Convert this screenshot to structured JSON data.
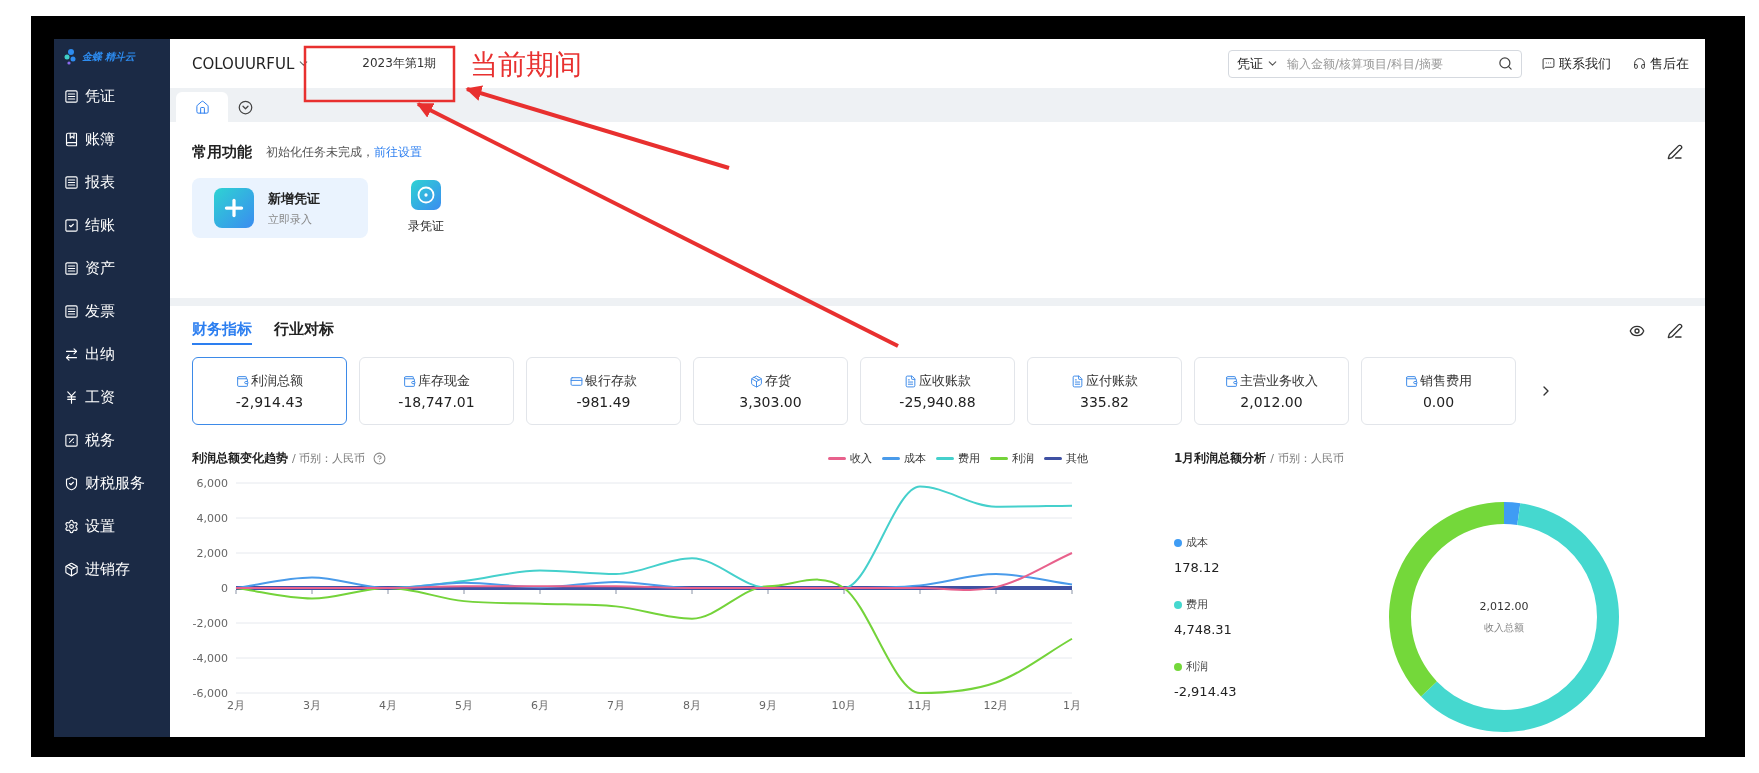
{
  "logo": {
    "text": "金蝶 精斗云"
  },
  "sidebar": {
    "items": [
      {
        "label": "凭证",
        "kind": "doc"
      },
      {
        "label": "账簿",
        "kind": "book"
      },
      {
        "label": "报表",
        "kind": "doc"
      },
      {
        "label": "结账",
        "kind": "check"
      },
      {
        "label": "资产",
        "kind": "doc"
      },
      {
        "label": "发票",
        "kind": "doc"
      },
      {
        "label": "出纳",
        "kind": "swap"
      },
      {
        "label": "工资",
        "kind": "yen"
      },
      {
        "label": "税务",
        "kind": "percent"
      },
      {
        "label": "财税服务",
        "kind": "shield"
      },
      {
        "label": "设置",
        "kind": "gear"
      },
      {
        "label": "进销存",
        "kind": "box"
      }
    ]
  },
  "header": {
    "company": "COLOUURFUL",
    "period": "2023年第1期",
    "search": {
      "scope": "凭证",
      "placeholder": "输入金额/核算项目/科目/摘要"
    },
    "links": [
      {
        "label": "联系我们",
        "kind": "chat"
      },
      {
        "label": "售后在",
        "kind": "headset"
      }
    ]
  },
  "tab_bar": {
    "tabs": [
      {
        "kind": "home",
        "selected": true
      }
    ]
  },
  "shortcuts": {
    "title": "常用功能",
    "notice": "初始化任务未完成，",
    "notice_link": "前往设置",
    "items": [
      {
        "kind": "card",
        "title": "新增凭证",
        "subtitle": "立即录入"
      },
      {
        "kind": "tile",
        "title": "录凭证"
      }
    ]
  },
  "metrics": {
    "tabs": [
      {
        "label": "财务指标",
        "selected": true
      },
      {
        "label": "行业对标",
        "selected": false
      }
    ],
    "cards": [
      {
        "label": "利润总额",
        "value": "-2,914.43",
        "kind": "wallet",
        "selected": true
      },
      {
        "label": "库存现金",
        "value": "-18,747.01",
        "kind": "wallet",
        "selected": false
      },
      {
        "label": "银行存款",
        "value": "-981.49",
        "kind": "card",
        "selected": false
      },
      {
        "label": "存货",
        "value": "3,303.00",
        "kind": "box",
        "selected": false
      },
      {
        "label": "应收账款",
        "value": "-25,940.88",
        "kind": "invoice",
        "selected": false
      },
      {
        "label": "应付账款",
        "value": "335.82",
        "kind": "invoice",
        "selected": false
      },
      {
        "label": "主营业务收入",
        "value": "2,012.00",
        "kind": "wallet",
        "selected": false
      },
      {
        "label": "销售费用",
        "value": "0.00",
        "kind": "wallet",
        "selected": false
      }
    ]
  },
  "trend": {
    "title": "利润总额变化趋势",
    "currency": "/ 币别：人民币",
    "chart_data": {
      "type": "line",
      "categories": [
        "2月",
        "3月",
        "4月",
        "5月",
        "6月",
        "7月",
        "8月",
        "9月",
        "10月",
        "11月",
        "12月",
        "1月"
      ],
      "ylim": [
        -6000,
        6000
      ],
      "grid": true,
      "yticks": [
        {
          "value": 6000,
          "label": "6,000"
        },
        {
          "value": 4000,
          "label": "4,000"
        },
        {
          "value": 2000,
          "label": "2,000"
        },
        {
          "value": 0,
          "label": "0"
        },
        {
          "value": -2000,
          "label": "-2,000"
        },
        {
          "value": -4000,
          "label": "-4,000"
        },
        {
          "value": -6000,
          "label": "-6,000"
        }
      ],
      "series": [
        {
          "name": "收入",
          "color": "#e8618c",
          "values": [
            0,
            0,
            0,
            100,
            100,
            100,
            0,
            0,
            0,
            0,
            50,
            2000
          ]
        },
        {
          "name": "成本",
          "color": "#4a9bea",
          "values": [
            0,
            600,
            0,
            300,
            50,
            350,
            0,
            0,
            0,
            150,
            800,
            200
          ]
        },
        {
          "name": "费用",
          "color": "#45d0cc",
          "values": [
            0,
            0,
            0,
            400,
            1000,
            800,
            1700,
            0,
            0,
            5800,
            4650,
            4700
          ]
        },
        {
          "name": "利润",
          "color": "#74d33a",
          "values": [
            0,
            -600,
            0,
            -750,
            -900,
            -1050,
            -1750,
            100,
            0,
            -6000,
            -5400,
            -2900
          ]
        },
        {
          "name": "其他",
          "color": "#3f51a3",
          "values": [
            0,
            0,
            0,
            0,
            0,
            0,
            0,
            0,
            0,
            0,
            0,
            0
          ]
        }
      ]
    }
  },
  "analysis": {
    "title": "1月利润总额分析",
    "currency": "/ 币别：人民币",
    "legend": [
      {
        "value": "178.12",
        "color": "#3f9cf4"
      },
      {
        "value": "4,748.31",
        "color": "#45d8cf"
      },
      {
        "value": "-2,914.43",
        "color": "#74d83a"
      }
    ],
    "center_value": "2,012.00",
    "center_label": "收入总额",
    "chart_data": {
      "type": "donut",
      "categories": [
        "成本",
        "费用",
        "利润"
      ],
      "values": [
        2.27,
        60.56,
        37.17
      ]
    }
  },
  "annotation": {
    "label": "当前期间"
  }
}
